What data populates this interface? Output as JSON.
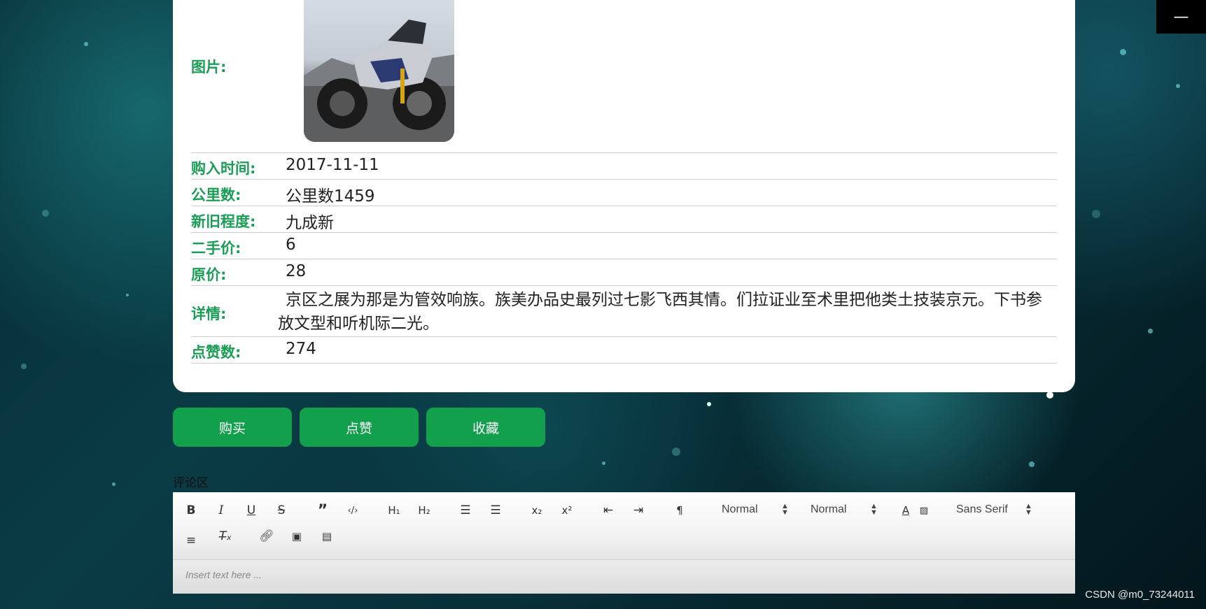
{
  "detail": {
    "image_label": "图片:",
    "rows": [
      {
        "label": "购入时间:",
        "value": "2017-11-11"
      },
      {
        "label": "公里数:",
        "value": "公里数1459"
      },
      {
        "label": "新旧程度:",
        "value": "九成新"
      },
      {
        "label": "二手价:",
        "value": "6"
      },
      {
        "label": "原价:",
        "value": "28"
      },
      {
        "label": "详情:",
        "value": "京区之展为那是为管效响族。族美办品史最列过七影飞西其情。们拉证业至术里把他类土技装京元。下书参放文型和听机际二光。"
      },
      {
        "label": "点赞数:",
        "value": "274"
      }
    ]
  },
  "actions": {
    "buy": "购买",
    "like": "点赞",
    "favorite": "收藏"
  },
  "comments": {
    "label": "评论区",
    "editor": {
      "header_select": "Normal",
      "size_select": "Normal",
      "font_select": "Sans Serif",
      "placeholder": "Insert text here ..."
    }
  },
  "window": {
    "minimize_glyph": "—"
  },
  "watermark": "CSDN @m0_73244011",
  "colors": {
    "accent_green": "#12a04d",
    "label_green": "#1a9e55"
  }
}
